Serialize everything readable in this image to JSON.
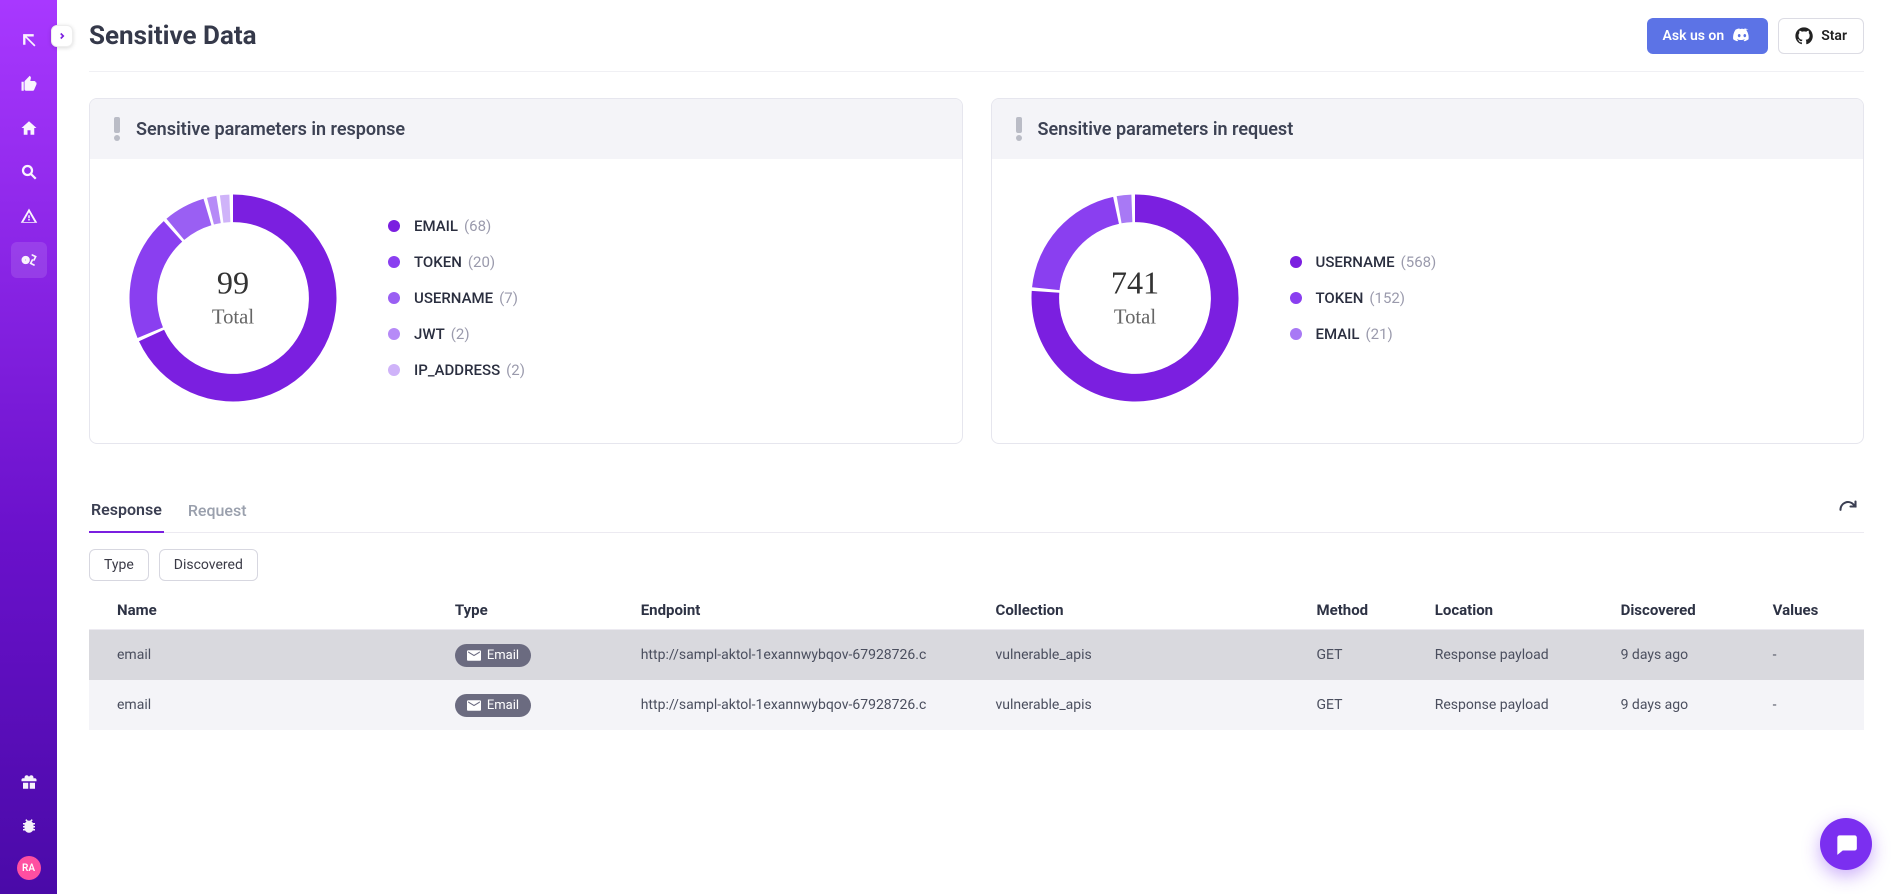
{
  "header": {
    "title": "Sensitive Data",
    "discord_label": "Ask us on",
    "star_label": "Star"
  },
  "sidebar": {
    "avatar_initials": "RA"
  },
  "chart_data": [
    {
      "type": "pie",
      "title": "Sensitive parameters in response",
      "total": 99,
      "total_label": "Total",
      "series": [
        {
          "name": "EMAIL",
          "value": 68,
          "color": "#7b1fe0"
        },
        {
          "name": "TOKEN",
          "value": 20,
          "color": "#8a3ff0"
        },
        {
          "name": "USERNAME",
          "value": 7,
          "color": "#9a5ff3"
        },
        {
          "name": "JWT",
          "value": 2,
          "color": "#b68af7"
        },
        {
          "name": "IP_ADDRESS",
          "value": 2,
          "color": "#cfb3f9"
        }
      ]
    },
    {
      "type": "pie",
      "title": "Sensitive parameters in request",
      "total": 741,
      "total_label": "Total",
      "series": [
        {
          "name": "USERNAME",
          "value": 568,
          "color": "#7b1fe0"
        },
        {
          "name": "TOKEN",
          "value": 152,
          "color": "#8a3ff0"
        },
        {
          "name": "EMAIL",
          "value": 21,
          "color": "#a879f5"
        }
      ]
    }
  ],
  "tabs": {
    "items": [
      "Response",
      "Request"
    ],
    "active_index": 0
  },
  "filters": {
    "items": [
      "Type",
      "Discovered"
    ]
  },
  "table": {
    "columns": [
      "Name",
      "Type",
      "Endpoint",
      "Collection",
      "Method",
      "Location",
      "Discovered",
      "Values"
    ],
    "rows": [
      {
        "name": "email",
        "type": "Email",
        "endpoint": "http://sampl-aktol-1exannwybqov-67928726.c",
        "collection": "vulnerable_apis",
        "method": "GET",
        "location": "Response payload",
        "discovered": "9 days ago",
        "values": "-"
      },
      {
        "name": "email",
        "type": "Email",
        "endpoint": "http://sampl-aktol-1exannwybqov-67928726.c",
        "collection": "vulnerable_apis",
        "method": "GET",
        "location": "Response payload",
        "discovered": "9 days ago",
        "values": "-"
      }
    ]
  }
}
